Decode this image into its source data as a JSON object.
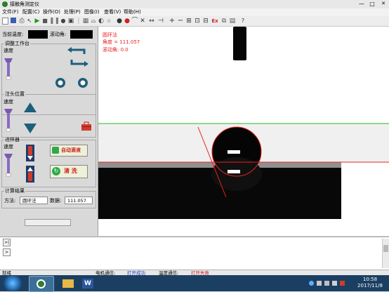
{
  "window": {
    "title": "接触角测定仪"
  },
  "window_controls": {
    "minimize": "—",
    "maximize": "□",
    "close": "✕"
  },
  "menu": [
    "文件(F)",
    "配置(C)",
    "操作(O)",
    "处理(P)",
    "图像(I)",
    "查看(V)",
    "帮助(H)"
  ],
  "toolbar_icons": [
    "new-icon",
    "save-icon",
    "print-icon",
    "pointer-icon",
    "play-icon",
    "stop-icon",
    "pause-icon",
    "record-icon",
    "camera-icon",
    "freeze-icon",
    "gray-icon",
    "drop-icon",
    "circle-fit-icon",
    "ellipse-fit-icon",
    "tangent-icon",
    "width-icon",
    "height-icon",
    "line-icon",
    "plus-icon",
    "minus-icon",
    "fit-icon",
    "zoom-icon",
    "expand-icon",
    "shrink-icon",
    "excel-icon",
    "copy-icon",
    "grid-icon",
    "help-icon"
  ],
  "left": {
    "temp_label": "当前温度:",
    "roll_label": "滚动角:",
    "worktable_title": "调整工作台",
    "speed_label": "速度",
    "needle_title": "注头位置",
    "injector_title": "进样器",
    "auto_drop_button": "自动滴液",
    "clean_button": "清 洗",
    "result_title": "计算结果",
    "method_label": "方法:",
    "method_value": "圆环法",
    "data_label": "数据:",
    "data_value": "111.057"
  },
  "overlay": {
    "method": "圆环法",
    "angle": "角度 = 111.057",
    "roll_angle": "滚动角: 0.0"
  },
  "bottom": {
    "btn1": ">|",
    "btn2": ">"
  },
  "status": {
    "ready": "就绪",
    "motor_label": "电机通信:",
    "motor_value": "打开成功",
    "temp_label": "温度通信:",
    "temp_value": "打开失败"
  },
  "taskbar": {
    "time": "10:58",
    "date": "2017/11/8",
    "word_label": "W"
  },
  "colors": {
    "overlay_text": "#e82020",
    "baseline": "#e82020",
    "reference_line": "#27c427",
    "arrow": "#1d5e7a",
    "taskbar": "#1b3f63"
  }
}
